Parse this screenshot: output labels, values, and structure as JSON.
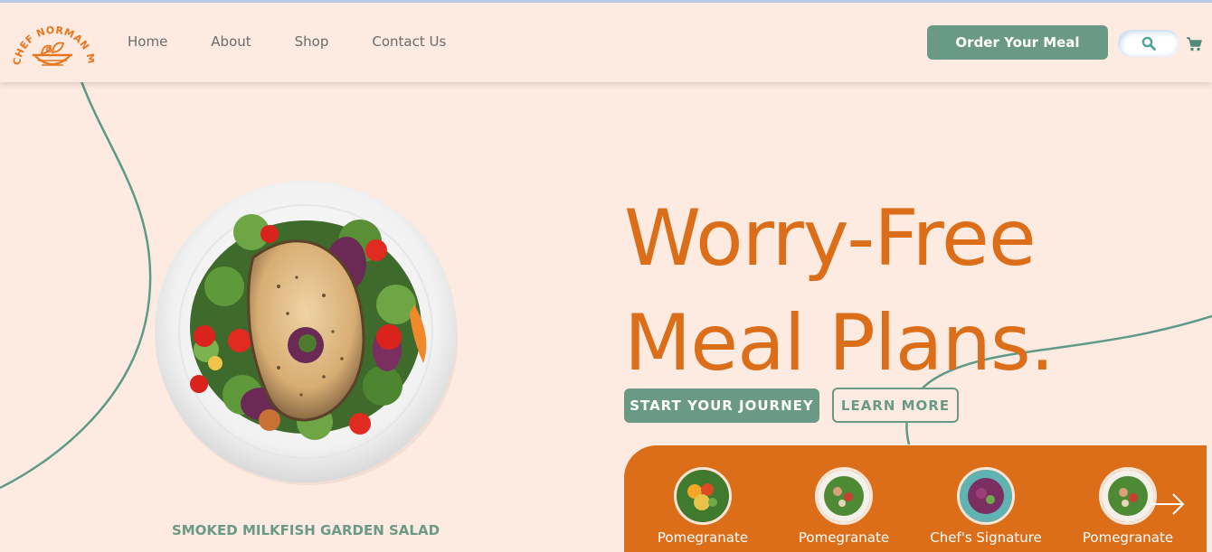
{
  "brand": {
    "name": "CHEF NORMAN MEALS"
  },
  "nav": {
    "items": [
      "Home",
      "About",
      "Shop",
      "Contact Us"
    ]
  },
  "header": {
    "order_label": "Order Your Meal"
  },
  "hero": {
    "title_line1": "Worry-Free",
    "title_line2": "Meal Plans.",
    "start_label": "START YOUR JOURNEY",
    "learn_label": "LEARN MORE",
    "dish_name": "SMOKED MILKFISH GARDEN SALAD"
  },
  "carousel": {
    "items": [
      {
        "label": "Pomegranate"
      },
      {
        "label": "Pomegranate"
      },
      {
        "label": "Chef's Signature"
      },
      {
        "label": "Pomegranate"
      }
    ]
  },
  "icons": {
    "search": "search-icon",
    "cart": "cart-icon",
    "next": "arrow-right-icon"
  },
  "colors": {
    "accent_orange": "#dc6e19",
    "accent_green": "#6a9a85",
    "background": "#fdebe1"
  }
}
